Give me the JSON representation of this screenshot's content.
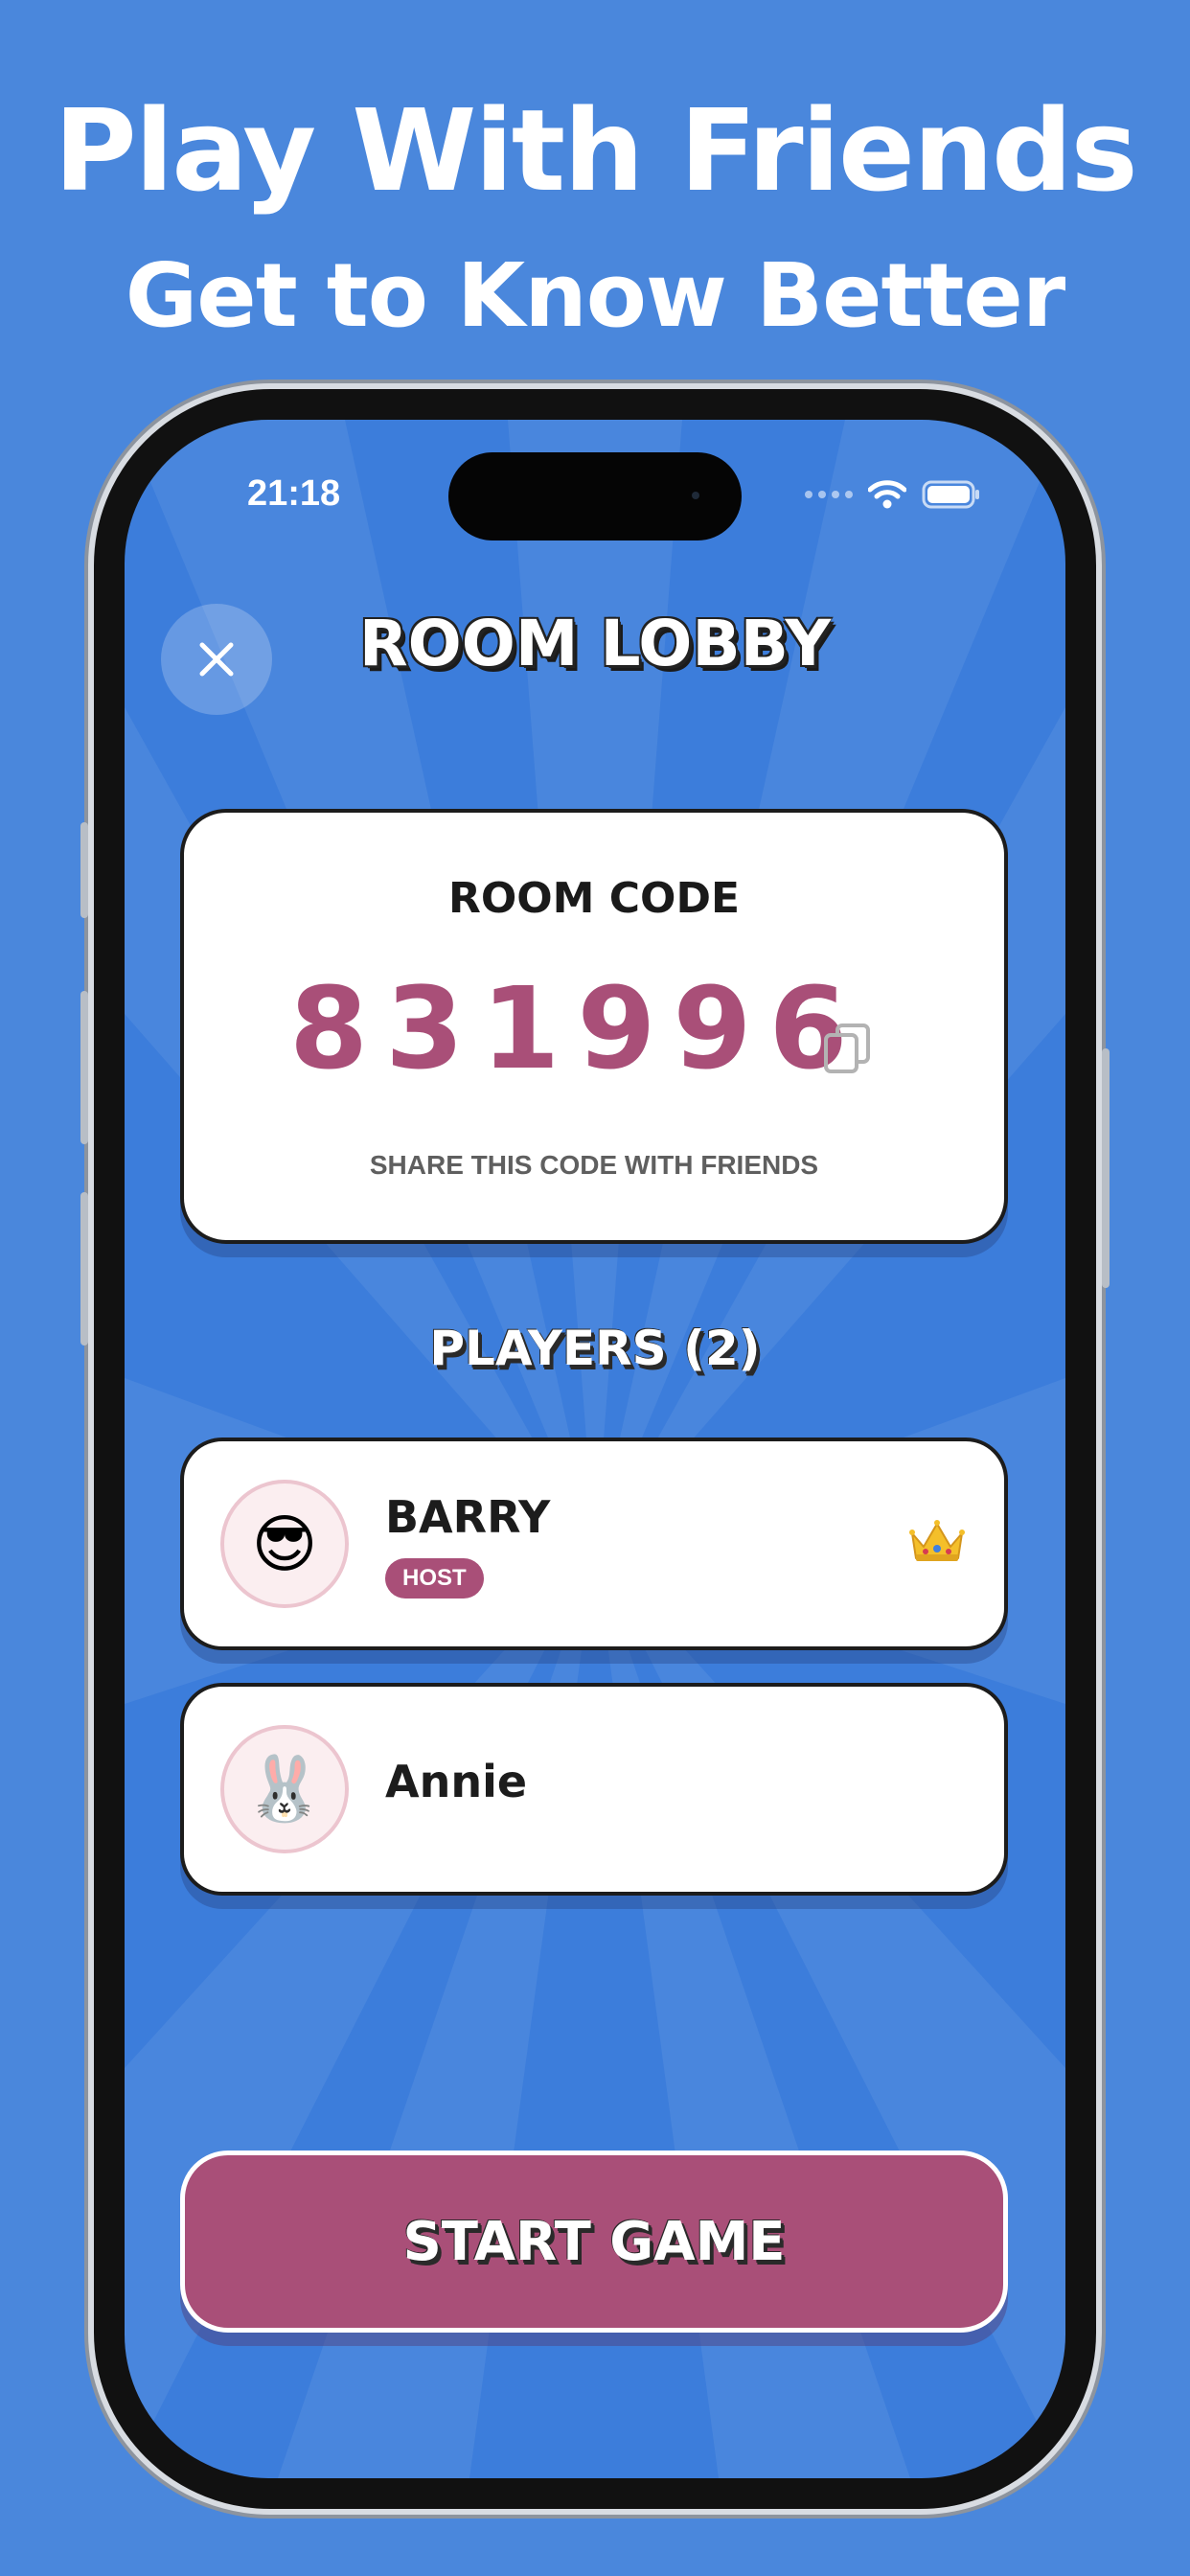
{
  "promo": {
    "title": "Play With Friends",
    "subtitle": "Get to Know Better"
  },
  "status_bar": {
    "time": "21:18"
  },
  "header": {
    "title": "ROOM LOBBY",
    "close_icon": "close-icon"
  },
  "room": {
    "label": "ROOM CODE",
    "code": "831996",
    "hint": "SHARE THIS CODE WITH FRIENDS",
    "copy_icon": "copy-icon"
  },
  "players": {
    "title": "PLAYERS (2)",
    "list": [
      {
        "name": "BARRY",
        "avatar": "😎",
        "badge": "HOST",
        "icon": "crown-icon"
      },
      {
        "name": "Annie",
        "avatar": "🐰"
      }
    ]
  },
  "actions": {
    "start_label": "START GAME"
  },
  "colors": {
    "background": "#4a87dc",
    "screen": "#3c7ddb",
    "accent": "#a94f78",
    "card": "#ffffff"
  }
}
